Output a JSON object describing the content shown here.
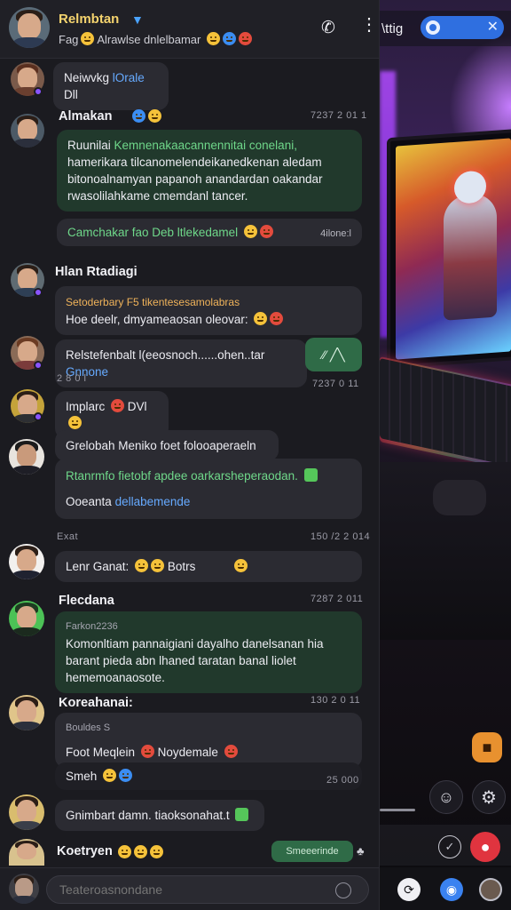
{
  "header": {
    "title": "Relmbtan",
    "verified_icon": "verified-icon",
    "subtitle": "Fag",
    "subtitle_rest": "Alrawlse dnlelbamar",
    "call_icon": "phone-icon",
    "more_icon": "more-vertical-icon"
  },
  "right_panel": {
    "tab_label": "\\ttig",
    "pill_close": "✕"
  },
  "messages": [
    {
      "text_a": "Neiwvkg",
      "text_b": "lOrale",
      "text_c": "Dll"
    },
    {
      "name": "Almakan",
      "time": "7237 2 01 1",
      "line1_a": "Ruunilai",
      "line1_b": "Kemnenakaacannennitai conelani,",
      "line2": "hamerikara tilcanomelendeikanedkenan aledam",
      "line3": "bitonoalnamyan papanoh anandardan oakandar",
      "line4": "rwasolilahkame cmemdanl tancer.",
      "footer": "Camchakar fao Deb ltlekedamel",
      "footer_time": "4ilone:l"
    },
    {
      "name": "Hlan Rtadiagi",
      "quote": "Setoderbary F5 tikentesesamolabras",
      "line1": "Hoe deelr, dmyameaosan oleovar:"
    },
    {
      "text_a": "Relstefenbalt l(eeosnoch......ohen..tar",
      "text_b": "Gnnone",
      "button": "⁄⁄ ╱╲"
    },
    {
      "meta": "2 8 0 l",
      "time": "7237 0 11"
    },
    {
      "text": "Implarc",
      "text_b": "DVl"
    },
    {
      "header_line": "Grelobah Meniko foet folooaperaeln",
      "line1": "Rtanrmfo fietobf apdee oarkarsheperaodan.",
      "line2_a": "Ooeanta",
      "line2_b": "dellabemende"
    },
    {
      "meta": "Exat",
      "time": "150 /2 2 014"
    },
    {
      "text": "Lenr Ganat:",
      "text_b": "Botrs"
    },
    {
      "name": "Flecdana",
      "time": "7287 2 011",
      "sub": "Farkon2236",
      "line1": "Komonltiam pannaigiani dayalho danelsanan hia",
      "line2": "barant pieda abn lhaned taratan banal liolet",
      "line3": "hememoanaosote."
    },
    {
      "name": "Koreahanai:",
      "time": "130 2 0 11",
      "sub": "Bouldes S",
      "line1_a": "Foot Meqlein",
      "line1_b": "Noydemale",
      "line2": "Smeh",
      "line2_time": "25 000"
    },
    {
      "text": "Gnimbart damn. tiaoksonahat.t"
    },
    {
      "name": "Koetryen",
      "tag": "Smeeerinde"
    }
  ],
  "composer": {
    "placeholder": "Teateroasnondane"
  },
  "icons": {
    "orange_fab": "chat-bubble-icon",
    "person": "person-icon",
    "gear": "gear-icon",
    "check": "check-circle-icon",
    "red": "record-icon"
  }
}
